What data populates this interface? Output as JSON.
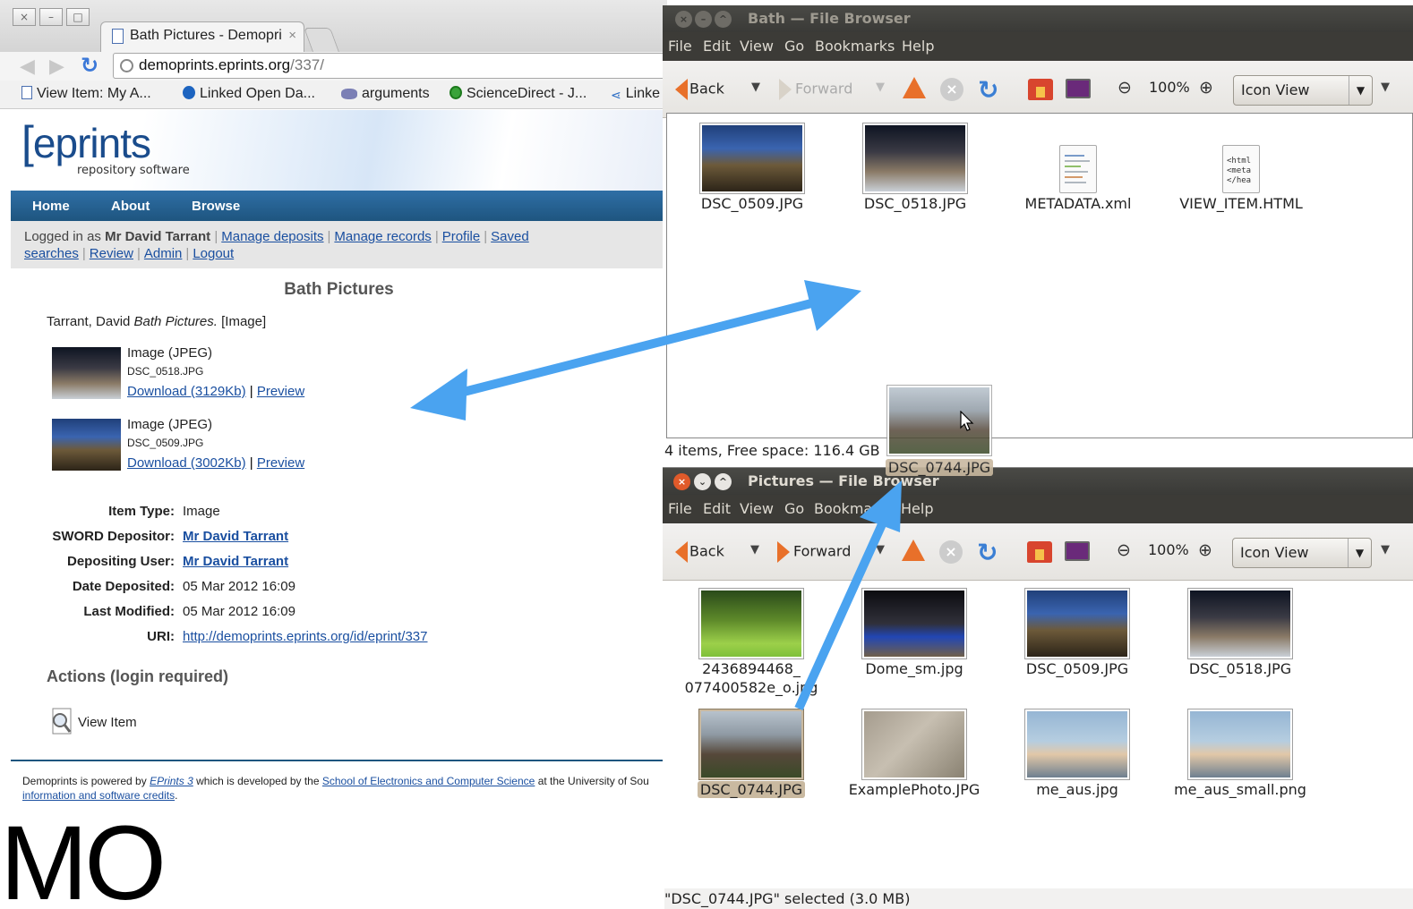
{
  "browser": {
    "tab_title": "Bath Pictures - Demopri",
    "tab_close": "×",
    "window_controls": [
      "×",
      "–",
      "□"
    ],
    "url_host": "demoprints.eprints.org",
    "url_path": "/337/",
    "bookmarks": [
      "View Item: My A...",
      "Linked Open Da...",
      "arguments",
      "ScienceDirect - J...",
      "Linke"
    ],
    "bookmark_icons": [
      "document-icon",
      "eprints-icon",
      "php-icon",
      "sciencedirect-icon",
      "share-icon"
    ]
  },
  "eprints": {
    "logo_text": "eprints",
    "logo_bracket": "e",
    "tagline": "repository software",
    "nav": [
      "Home",
      "About",
      "Browse"
    ],
    "logged_in_prefix": "Logged in as",
    "logged_in_user": "Mr David Tarrant",
    "user_links": [
      "Manage deposits",
      "Manage records",
      "Profile",
      "Saved searches",
      "Review",
      "Admin",
      "Logout"
    ],
    "title": "Bath Pictures",
    "citation_author": "Tarrant, David",
    "citation_title": "Bath Pictures.",
    "citation_type": "[Image]",
    "documents": [
      {
        "format": "Image (JPEG)",
        "filename": "DSC_0518.JPG",
        "download": "Download (3129Kb)",
        "preview": "Preview"
      },
      {
        "format": "Image (JPEG)",
        "filename": "DSC_0509.JPG",
        "download": "Download (3002Kb)",
        "preview": "Preview"
      }
    ],
    "meta": [
      {
        "key": "Item Type:",
        "value": "Image",
        "link": false
      },
      {
        "key": "SWORD Depositor:",
        "value": "Mr David Tarrant",
        "link": true
      },
      {
        "key": "Depositing User:",
        "value": "Mr David Tarrant",
        "link": true
      },
      {
        "key": "Date Deposited:",
        "value": "05 Mar 2012 16:09",
        "link": false
      },
      {
        "key": "Last Modified:",
        "value": "05 Mar 2012 16:09",
        "link": false
      },
      {
        "key": "URI:",
        "value": "http://demoprints.eprints.org/id/eprint/337",
        "link": true
      }
    ],
    "actions_heading": "Actions (login required)",
    "view_item": "View Item",
    "footer_pre": "Demoprints is powered by",
    "footer_eprints": "EPrints 3",
    "footer_mid": "which is developed by the",
    "footer_school": "School of Electronics and Computer Science",
    "footer_post": "at the University of Sou",
    "footer_credits": "information and software credits",
    "footer_end": "."
  },
  "overlay_text": "MO",
  "bath_window": {
    "title": "Bath — File Browser",
    "menu": [
      "File",
      "Edit",
      "View",
      "Go",
      "Bookmarks",
      "Help"
    ],
    "back": "Back",
    "forward": "Forward",
    "zoom": "100%",
    "view_mode": "Icon View",
    "files": [
      "DSC_0509.JPG",
      "DSC_0518.JPG",
      "METADATA.xml",
      "VIEW_ITEM.HTML"
    ],
    "html_icon_text": "<html\n<meta\n</hea",
    "status": "4 items, Free space: 116.4 GB"
  },
  "drag": {
    "filename": "DSC_0744.JPG"
  },
  "pictures_window": {
    "title": "Pictures — File Browser",
    "menu": [
      "File",
      "Edit",
      "View",
      "Go",
      "Bookmarks",
      "Help"
    ],
    "back": "Back",
    "forward": "Forward",
    "zoom": "100%",
    "view_mode": "Icon View",
    "files": [
      "2436894468_\n077400582e_o.jpg",
      "Dome_sm.jpg",
      "DSC_0509.JPG",
      "DSC_0518.JPG",
      "DSC_0744.JPG",
      "ExamplePhoto.JPG",
      "me_aus.jpg",
      "me_aus_small.png"
    ],
    "selected": "DSC_0744.JPG",
    "status": "\"DSC_0744.JPG\" selected (3.0 MB)"
  },
  "colors": {
    "arrow": "#4aa3f0",
    "eprints_nav": "#1e557f",
    "link": "#1a4fa0",
    "titlebar": "#3c3b37",
    "ubuntu_orange": "#e8702a"
  }
}
